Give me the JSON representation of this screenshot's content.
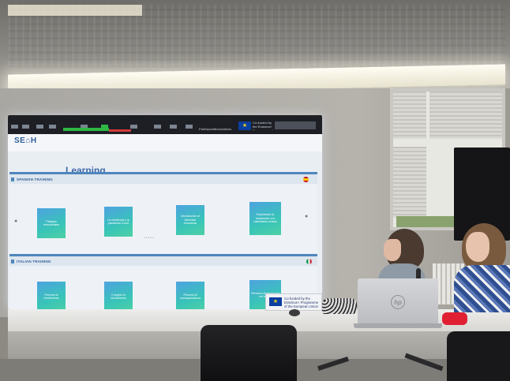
{
  "slide": {
    "logo": "SE⌂H",
    "page_title": "Learning",
    "toolbar_labels": [
      "Participants",
      "Annotations"
    ],
    "eu_badge_text": "Co-funded by the Erasmus+ Programme of the European Union",
    "sections": [
      {
        "heading": "SPANISH TRAINING",
        "flag": "spain",
        "cards": [
          "Paisajes emocionales",
          "La resiliencia y la pandemia Covid",
          "Introducción al bienestar emocional",
          "Explorando la respiración a la naturaleza urbana"
        ]
      },
      {
        "heading": "ITALIAN TRAINING",
        "flag": "italy",
        "cards": [
          "Percorsi di mindfulness",
          "Il respiro in mindfulness",
          "Percorsi di consapevolezza",
          "Percorso di benessere nel bosco"
        ]
      }
    ]
  },
  "sticker": {
    "text": "Co-funded by the Erasmus+ Programme of the European Union"
  },
  "laptop": {
    "brand": "hp"
  }
}
